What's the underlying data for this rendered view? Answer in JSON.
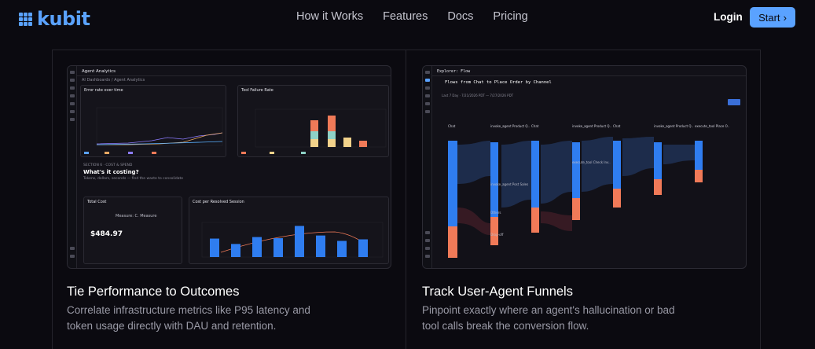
{
  "brand": {
    "name": "kubit",
    "accent": "#5aa2ff"
  },
  "nav": {
    "links": [
      "How it Works",
      "Features",
      "Docs",
      "Pricing"
    ],
    "login": "Login",
    "start": "Start"
  },
  "cards": [
    {
      "title": "Tie Performance to Outcomes",
      "description": "Correlate infrastructure metrics like P95 latency and token usage directly with DAU and retention.",
      "screenshot": {
        "app_title": "Agent Analytics",
        "breadcrumb": "AI Dashboards / Agent Analytics",
        "panel_error": "Error rate over time",
        "panel_tool": "Tool Failure Rate",
        "section_label": "SECTION 6 · COST & SPEND",
        "section_heading": "What's it costing?",
        "section_sub": "Tokens, dollars, seconds — find the waste to consolidate",
        "total_cost_title": "Total Cost",
        "total_cost_value": "$484.97",
        "cost_panel_title": "Cost per Resolved Session",
        "measure_label": "Measure: C. Measure",
        "bar_values": [
          480,
          340,
          520,
          490,
          810,
          560,
          420,
          460
        ]
      }
    },
    {
      "title": "Track User-Agent Funnels",
      "description": "Pinpoint exactly where an agent's hallucination or bad tool calls break the conversion flow.",
      "screenshot": {
        "app_title": "Explorer: Flow",
        "flow_title": "Flows from Chat to Place Order by Channel",
        "range": "Last 7 Day · 7/21/2026 PDT — 7/27/2026 PDT",
        "columns": [
          "Chat",
          "invoke_agent Product Q..",
          "Chat",
          "invoke_agent Product Q..",
          "Chat",
          "invoke_agent Product Q..",
          "execute_tool Place O.."
        ],
        "nodes": [
          "Others",
          "Drop-off",
          "invoke_agent Post Sales",
          "execute_tool Check Inv.."
        ]
      }
    }
  ]
}
